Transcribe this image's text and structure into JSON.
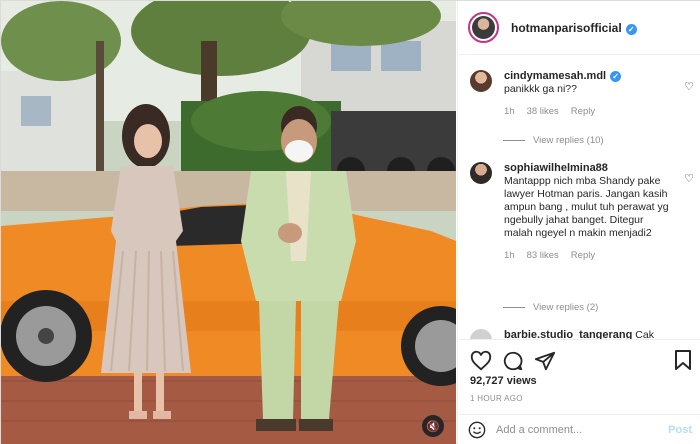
{
  "post": {
    "username": "hotmanparisofficial",
    "verified": true,
    "mute_icon": "speaker-muted-icon"
  },
  "comments": [
    {
      "username": "cindymamesah.mdl",
      "verified": true,
      "text": "panikkk ga ni??",
      "age": "1h",
      "likes": "38 likes",
      "reply_label": "Reply",
      "view_replies": "View replies (10)"
    },
    {
      "username": "sophiawilhelmina88",
      "verified": false,
      "text": "Mantappp nich mba Shandy pake lawyer Hotman paris. Jangan kasih ampun bang , mulut tuh perawat yg ngebully jahat banget. Ditegur malah ngeyel n makin menjadi2",
      "age": "1h",
      "likes": "83 likes",
      "reply_label": "Reply",
      "view_replies": "View replies (2)"
    },
    {
      "username": "barbie.studio_tangerang",
      "text": "Cak"
    }
  ],
  "actions": {
    "like_icon": "heart-icon",
    "comment_icon": "comment-bubble-icon",
    "share_icon": "paper-plane-icon",
    "save_icon": "bookmark-icon"
  },
  "stats": {
    "views": "92,727 views",
    "time_ago": "1 HOUR AGO"
  },
  "composer": {
    "placeholder": "Add a comment...",
    "post_label": "Post"
  },
  "colors": {
    "verified_blue": "#3897f0",
    "post_disabled": "#b2dffc",
    "car_orange": "#f08a24"
  }
}
